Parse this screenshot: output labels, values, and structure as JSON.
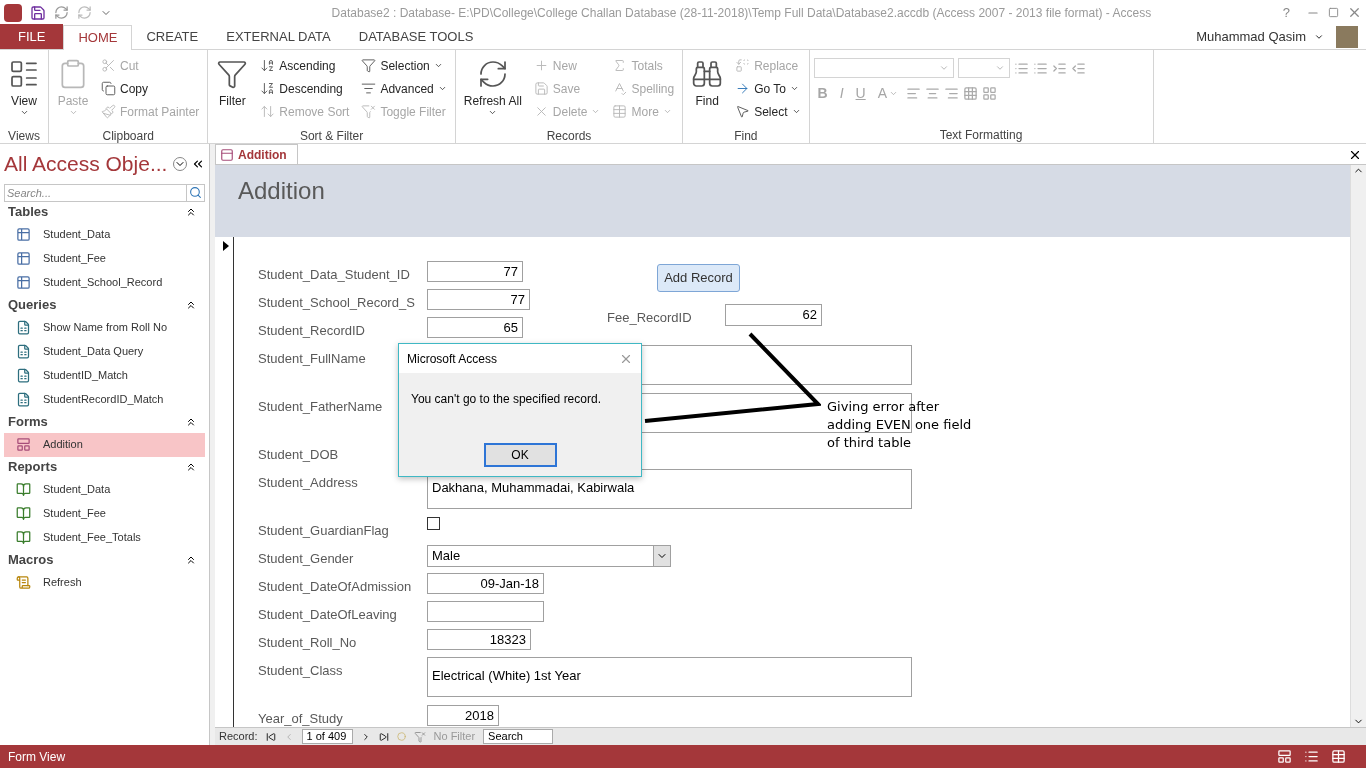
{
  "window": {
    "title": "Database2 : Database- E:\\PD\\College\\College Challan Database (28-11-2018)\\Temp Full Data\\Database2.accdb (Access 2007 - 2013 file format) - Access",
    "help": "?",
    "user": "Muhammad Qasim"
  },
  "ribbon_tabs": [
    {
      "label": "FILE",
      "kind": "file",
      "selected": false
    },
    {
      "label": "HOME",
      "kind": "tab",
      "selected": true
    },
    {
      "label": "CREATE",
      "kind": "tab",
      "selected": false
    },
    {
      "label": "EXTERNAL DATA",
      "kind": "tab",
      "selected": false
    },
    {
      "label": "DATABASE TOOLS",
      "kind": "tab",
      "selected": false
    }
  ],
  "ribbon_groups": [
    {
      "label": "Views",
      "items": [
        {
          "label": "View",
          "kind": "large",
          "dropdown": true,
          "disabled": false
        }
      ]
    },
    {
      "label": "Clipboard",
      "items": [
        {
          "label": "Paste",
          "kind": "large",
          "dropdown": true,
          "disabled": true
        },
        {
          "label": "Cut",
          "kind": "small",
          "dropdown": false,
          "disabled": true
        },
        {
          "label": "Copy",
          "kind": "small",
          "dropdown": false,
          "disabled": false
        },
        {
          "label": "Format Painter",
          "kind": "small",
          "dropdown": false,
          "disabled": true
        }
      ]
    },
    {
      "label": "Sort & Filter",
      "items": [
        {
          "label": "Filter",
          "kind": "large",
          "dropdown": false,
          "disabled": false
        },
        {
          "label": "Ascending",
          "kind": "small",
          "dropdown": false,
          "disabled": false
        },
        {
          "label": "Descending",
          "kind": "small",
          "dropdown": false,
          "disabled": false
        },
        {
          "label": "Remove Sort",
          "kind": "small",
          "dropdown": false,
          "disabled": true
        },
        {
          "label": "Selection",
          "kind": "small",
          "dropdown": true,
          "disabled": false
        },
        {
          "label": "Advanced",
          "kind": "small",
          "dropdown": true,
          "disabled": false
        },
        {
          "label": "Toggle Filter",
          "kind": "small",
          "dropdown": false,
          "disabled": true
        }
      ]
    },
    {
      "label": "Records",
      "items": [
        {
          "label": "Refresh All",
          "kind": "large",
          "dropdown": true,
          "disabled": false
        },
        {
          "label": "New",
          "kind": "small",
          "dropdown": false,
          "disabled": true
        },
        {
          "label": "Save",
          "kind": "small",
          "dropdown": false,
          "disabled": true
        },
        {
          "label": "Delete",
          "kind": "small",
          "dropdown": true,
          "disabled": true
        },
        {
          "label": "Totals",
          "kind": "small",
          "dropdown": false,
          "disabled": true
        },
        {
          "label": "Spelling",
          "kind": "small",
          "dropdown": false,
          "disabled": true
        },
        {
          "label": "More",
          "kind": "small",
          "dropdown": true,
          "disabled": true
        }
      ]
    },
    {
      "label": "Find",
      "items": [
        {
          "label": "Find",
          "kind": "large",
          "dropdown": false,
          "disabled": false
        },
        {
          "label": "Replace",
          "kind": "small",
          "dropdown": false,
          "disabled": true
        },
        {
          "label": "Go To",
          "kind": "small",
          "dropdown": true,
          "disabled": false
        },
        {
          "label": "Select",
          "kind": "small",
          "dropdown": true,
          "disabled": false
        }
      ]
    },
    {
      "label": "Text Formatting",
      "items": [
        {
          "label": "B",
          "kind": "letter",
          "dropdown": false,
          "disabled": true
        },
        {
          "label": "I",
          "kind": "letter",
          "dropdown": false,
          "disabled": true
        },
        {
          "label": "U",
          "kind": "letter",
          "dropdown": false,
          "disabled": true
        },
        {
          "label": "A",
          "kind": "letter",
          "dropdown": true,
          "disabled": true
        }
      ]
    }
  ],
  "nav_pane": {
    "title": "All Access Obje...",
    "search": {
      "placeholder": "Search..."
    },
    "groups": [
      {
        "label": "Tables",
        "kind": "table",
        "items": [
          {
            "label": "Student_Data",
            "selected": false
          },
          {
            "label": "Student_Fee",
            "selected": false
          },
          {
            "label": "Student_School_Record",
            "selected": false
          }
        ]
      },
      {
        "label": "Queries",
        "kind": "query",
        "items": [
          {
            "label": "Show Name from Roll No",
            "selected": false
          },
          {
            "label": "Student_Data Query",
            "selected": false
          },
          {
            "label": "StudentID_Match",
            "selected": false
          },
          {
            "label": "StudentRecordID_Match",
            "selected": false
          }
        ]
      },
      {
        "label": "Forms",
        "kind": "form",
        "items": [
          {
            "label": "Addition",
            "selected": true
          }
        ]
      },
      {
        "label": "Reports",
        "kind": "report",
        "items": [
          {
            "label": "Student_Data",
            "selected": false
          },
          {
            "label": "Student_Fee",
            "selected": false
          },
          {
            "label": "Student_Fee_Totals",
            "selected": false
          }
        ]
      },
      {
        "label": "Macros",
        "kind": "macro",
        "items": [
          {
            "label": "Refresh",
            "selected": false
          }
        ]
      }
    ]
  },
  "document_tab": {
    "label": "Addition"
  },
  "form": {
    "header": "Addition",
    "add_button": "Add Record",
    "fields": [
      {
        "label": "Student_Data_Student_ID",
        "kind": "number",
        "value": "77"
      },
      {
        "label": "Student_School_Record_S",
        "kind": "number",
        "value": "77"
      },
      {
        "label": "Student_RecordID",
        "kind": "number",
        "value": "65"
      },
      {
        "label": "Student_FullName",
        "kind": "memo"
      },
      {
        "label": "Student_FatherName",
        "kind": "memo"
      },
      {
        "label": "Student_DOB",
        "kind": "label"
      },
      {
        "label": "Student_Address",
        "kind": "memo",
        "value": "Dakhana, Muhammadai, Kabirwala"
      },
      {
        "label": "Student_GuardianFlag",
        "kind": "checkbox",
        "checked": false
      },
      {
        "label": "Student_Gender",
        "kind": "combo",
        "value": "Male"
      },
      {
        "label": "Student_DateOfAdmission",
        "kind": "number",
        "value": "09-Jan-18"
      },
      {
        "label": "Student_DateOfLeaving",
        "kind": "number"
      },
      {
        "label": "Student_Roll_No",
        "kind": "number",
        "value": "18323"
      },
      {
        "label": "Student_Class",
        "kind": "memo",
        "value": "Electrical (White) 1st Year"
      },
      {
        "label": "Year_of_Study",
        "kind": "number",
        "value": "2018"
      }
    ],
    "fee_field": {
      "label": "Fee_RecordID",
      "value": "62"
    }
  },
  "annotation": {
    "lines": [
      "Giving error after",
      "adding EVEN one field",
      "of third table"
    ]
  },
  "dialog": {
    "title": "Microsoft Access",
    "message": "You can't go to the specified record.",
    "button": "OK"
  },
  "record_nav": {
    "label": "Record:",
    "position": "1 of 409",
    "filter": "No Filter",
    "search": {
      "placeholder": "Search"
    }
  },
  "status_bar": {
    "text": "Form View"
  }
}
